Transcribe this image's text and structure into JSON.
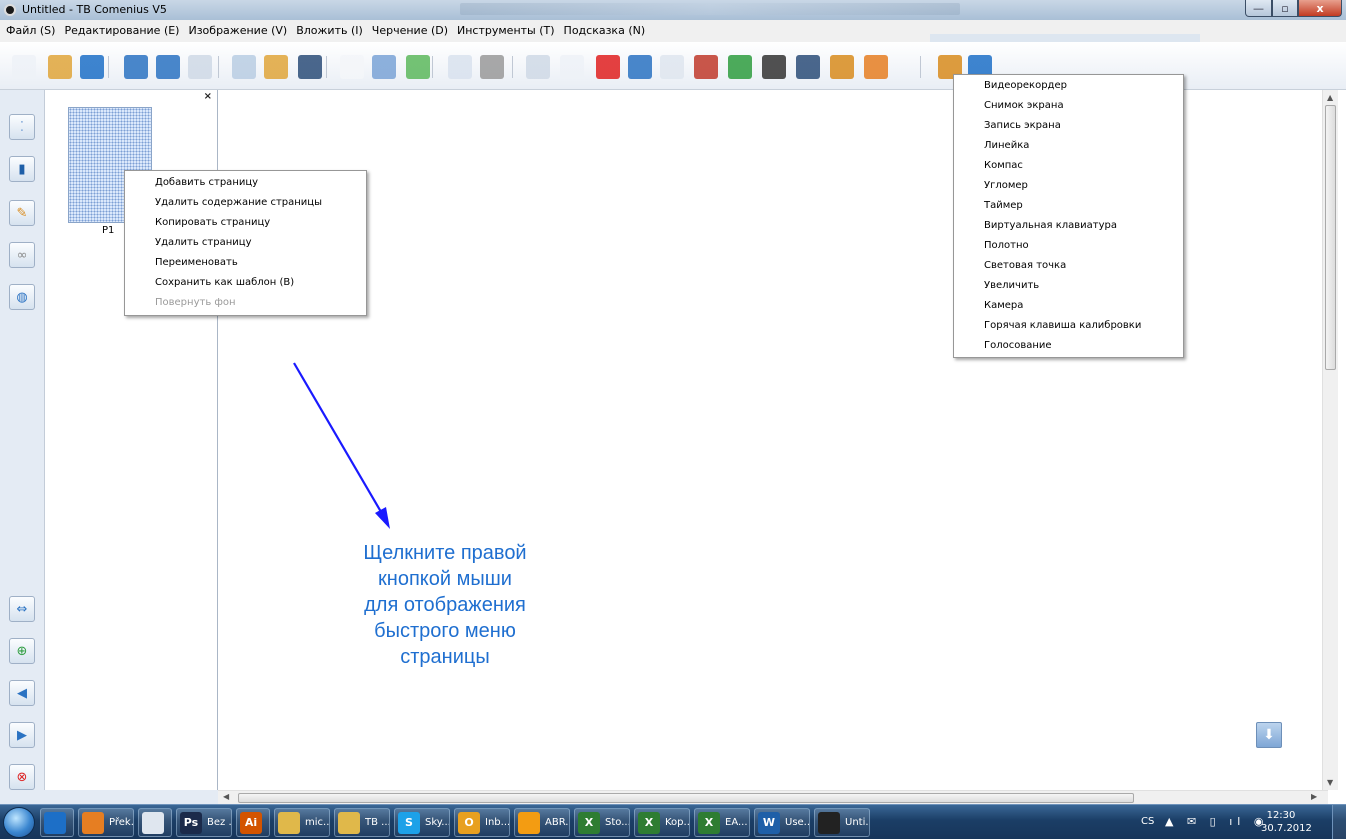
{
  "window": {
    "title": "Untitled - TB Comenius V5",
    "min_symbol": "—",
    "max_symbol": "▫",
    "close_symbol": "x"
  },
  "menubar": {
    "items": [
      "Файл (S)",
      "Редактирование (E)",
      "Изображение (V)",
      "Вложить (I)",
      "Черчение (D)",
      "Инструменты (T)",
      "Подсказка (N)"
    ]
  },
  "page_panel": {
    "close_symbol": "×",
    "thumb_label": "P1"
  },
  "page_menu": {
    "items": [
      {
        "label": "Добавить страницу",
        "enabled": true
      },
      {
        "label": "Удалить содержание страницы",
        "enabled": true
      },
      {
        "label": "Копировать страницу",
        "enabled": true
      },
      {
        "label": "Удалить страницу",
        "enabled": true
      },
      {
        "label": "Переименовать",
        "enabled": true
      },
      {
        "label": "Сохранить как шаблон (B)",
        "enabled": true
      },
      {
        "label": "Повернуть фон",
        "enabled": false
      }
    ]
  },
  "tools_menu": {
    "items": [
      "Видеорекордер",
      "Снимок экрана",
      "Запись экрана",
      "Линейка",
      "Компас",
      "Угломер",
      "Таймер",
      "Виртуальная клавиатура",
      "Полотно",
      "Световая точка",
      "Увеличить",
      "Камера",
      "Горячая клавиша калибровки",
      "Голосование"
    ]
  },
  "annotation": {
    "lines": [
      "Щелкните правой",
      "кнопкой мыши",
      "для отображения",
      "быстрого меню",
      "страницы"
    ],
    "color": "#1f6fd0"
  },
  "taskbar": {
    "buttons": [
      {
        "icon": "user-icon",
        "label": ""
      },
      {
        "icon": "firefox-icon",
        "label": "Přek..."
      },
      {
        "icon": "clock-icon",
        "label": ""
      },
      {
        "icon": "photoshop-icon",
        "glyph": "Ps",
        "label": "Bez ..."
      },
      {
        "icon": "illustrator-icon",
        "glyph": "Ai",
        "label": ""
      },
      {
        "icon": "folder-icon",
        "label": "mic..."
      },
      {
        "icon": "folder-icon",
        "label": "TB ..."
      },
      {
        "icon": "skype-icon",
        "glyph": "S",
        "label": "Sky..."
      },
      {
        "icon": "outlook-icon",
        "glyph": "O",
        "label": "Inb..."
      },
      {
        "icon": "abbyy-icon",
        "label": "ABR..."
      },
      {
        "icon": "excel-icon",
        "glyph": "X",
        "label": "Sto..."
      },
      {
        "icon": "excel-icon",
        "glyph": "X",
        "label": "Kop..."
      },
      {
        "icon": "excel-icon",
        "glyph": "X",
        "label": "EA..."
      },
      {
        "icon": "word-icon",
        "glyph": "W",
        "label": "Use..."
      },
      {
        "icon": "comenius-icon",
        "label": "Unti..."
      }
    ],
    "tray": {
      "lang": "CS",
      "time": "12:30",
      "date": "30.7.2012"
    }
  }
}
